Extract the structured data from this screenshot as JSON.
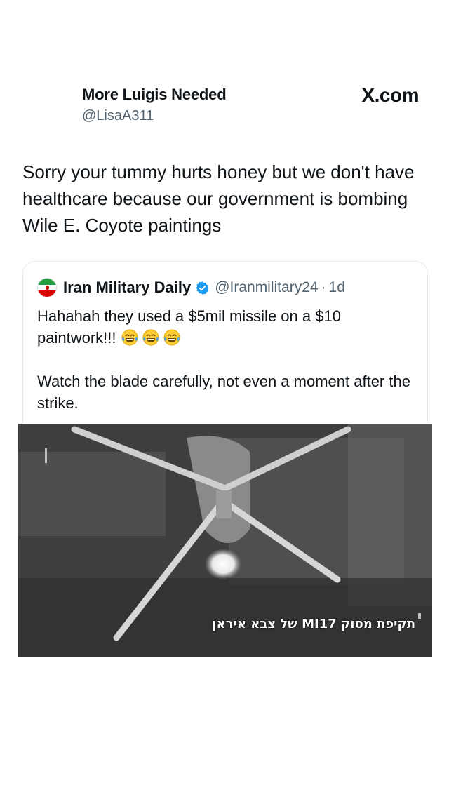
{
  "tweet": {
    "display_name": "More Luigis Needed",
    "handle": "@LisaA311",
    "brand": "X.com",
    "text": "Sorry your tummy hurts honey but we don't have healthcare because our government is bombing Wile E. Coyote paintings"
  },
  "quoted": {
    "name": "Iran Military Daily",
    "handle": "@Iranmilitary24",
    "separator": "·",
    "time": "1d",
    "paragraph1": "Hahahah they used a $5mil missile on a $10 paintwork!!!",
    "emojis": [
      "face-with-tears-of-joy-icon",
      "face-with-tears-of-joy-icon",
      "face-with-tears-of-joy-icon"
    ],
    "paragraph2": "Watch the blade carefully, not even a moment after the strike.",
    "video": {
      "caption": "תקיפת מסוק MI17 של צבא איראן"
    }
  },
  "colors": {
    "text": "#0f1419",
    "secondary": "#536471",
    "verified": "#1d9bf0",
    "card_border": "#e6eaed"
  }
}
